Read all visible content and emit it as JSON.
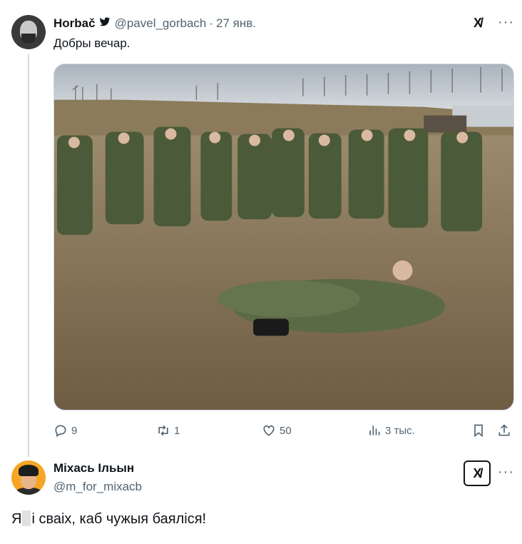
{
  "tweet1": {
    "author_name": "Horbač",
    "author_handle": "@pavel_gorbach",
    "date": "27 янв.",
    "text": "Добры вечар.",
    "verified_icon": "bird-verified-icon",
    "photo_icon": "photo",
    "actions": {
      "replies": "9",
      "retweets": "1",
      "likes": "50",
      "views": "3 тыс."
    }
  },
  "tweet2": {
    "author_name": "Міхась Ільын",
    "author_handle": "@m_for_mixacb",
    "text_before": "Я",
    "text_after": "і сваіх, каб чужыя баяліся!"
  },
  "colors": {
    "text": "#0f1419",
    "muted": "#536471",
    "border": "#cfd9de",
    "redaction": "#e1e1e1"
  }
}
